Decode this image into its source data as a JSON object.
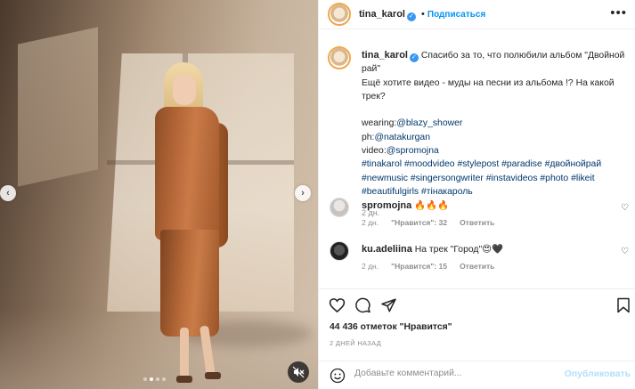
{
  "post": {
    "username": "tina_karol",
    "follow_label": "Подписаться",
    "more_label": "•••",
    "caption": {
      "line1": "Спасибо за то, что полюбили альбом \"Двойной рай\"",
      "line2": "Ещё хотите видео - муды на песни из альбома !? На какой трек?",
      "wearing_prefix": "wearing:",
      "wearing_link": "@blazy_shower",
      "ph_prefix": "ph:",
      "ph_link": "@natakurgan",
      "video_prefix": "video:",
      "video_link": "@spromojna",
      "hashtags": "#tinakarol #moodvideo #stylepost #paradise #двойнойрай #newmusic #singersongwriter #instavideos #photo #likeit #beautifulgirls #тінакароль",
      "time": "2 дн."
    },
    "comments": [
      {
        "username": "spromojna",
        "text": "🔥🔥🔥",
        "time": "2 дн.",
        "likes": "\"Нравится\": 32",
        "reply": "Ответить"
      },
      {
        "username": "ku.adeliina",
        "text": "На трек \"Город\"😍🖤",
        "time": "2 дн.",
        "likes": "\"Нравится\": 15",
        "reply": "Ответить"
      }
    ],
    "views": "44 436 отметок \"Нравится\"",
    "date": "2 ДНЕЙ НАЗАД",
    "comment_placeholder": "Добавьте комментарий...",
    "publish_label": "Опубликовать"
  },
  "media": {
    "prev_arrow": "‹",
    "next_arrow": "›",
    "slide_count": 4,
    "active_slide": 2
  },
  "icons": {
    "verified": "verified-badge-icon",
    "heart": "heart-icon",
    "comment": "comment-icon",
    "share": "send-icon",
    "save": "bookmark-icon",
    "emoji": "smiley-icon",
    "mute": "speaker-muted-icon"
  },
  "colors": {
    "accent": "#0095f6",
    "publish_disabled": "#b2dffc",
    "link": "#00376b"
  }
}
